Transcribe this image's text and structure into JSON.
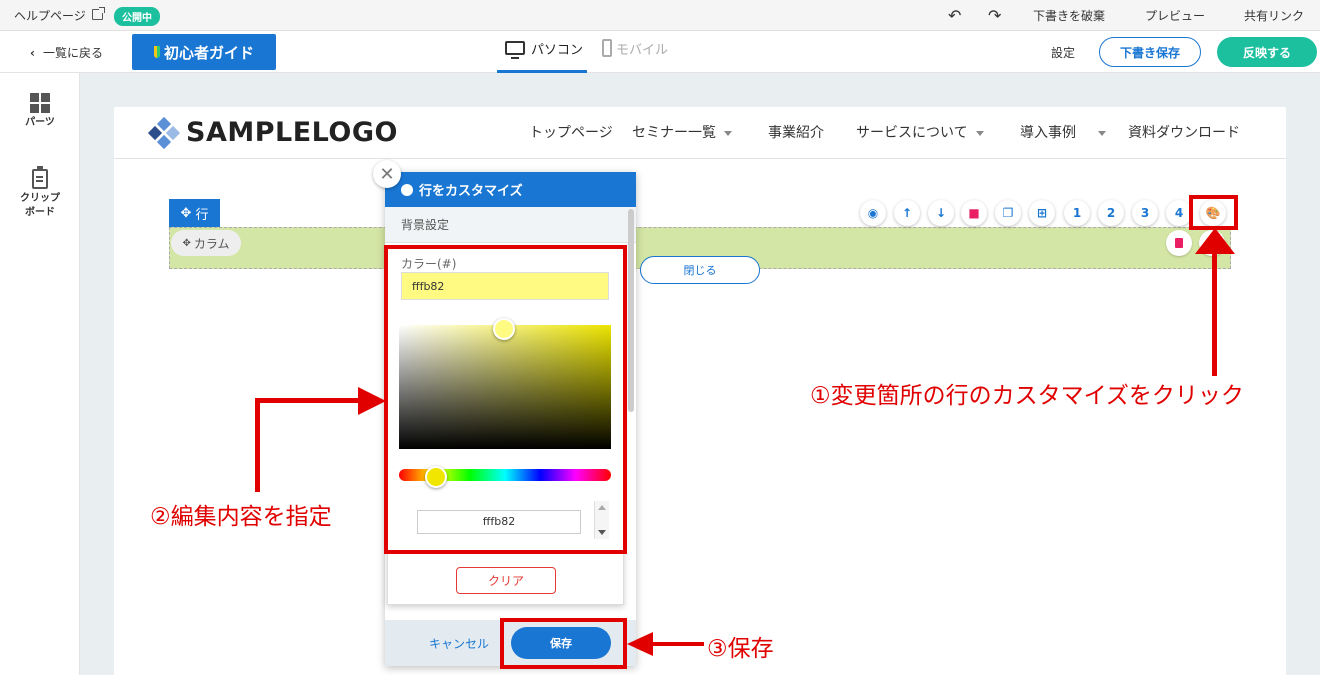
{
  "topbar": {
    "help_label": "ヘルプページ",
    "status_badge": "公開中",
    "discard_draft": "下書きを破棄",
    "preview": "プレビュー",
    "share_link": "共有リンク"
  },
  "toolbar": {
    "back_label": "一覧に戻る",
    "guide_label": "初心者ガイド",
    "device_tabs": [
      {
        "label": "パソコン",
        "active": true
      },
      {
        "label": "モバイル",
        "active": false
      }
    ],
    "settings_label": "設定",
    "draft_save_label": "下書き保存",
    "publish_label": "反映する"
  },
  "sidebar": {
    "items": [
      {
        "label": "パーツ",
        "icon": "grid-icon"
      },
      {
        "label": "クリップ\nボード",
        "icon": "clipboard-icon"
      }
    ]
  },
  "site": {
    "logo_text": "SAMPLELOGO",
    "nav": [
      {
        "label": "トップページ",
        "dropdown": false
      },
      {
        "label": "セミナー一覧",
        "dropdown": true
      },
      {
        "label": "事業紹介",
        "dropdown": false
      },
      {
        "label": "サービスについて",
        "dropdown": true
      },
      {
        "label": "導入事例",
        "dropdown": true
      },
      {
        "label": "資料ダウンロード",
        "dropdown": false
      }
    ]
  },
  "row": {
    "handle_label": "行",
    "column_label": "カラム",
    "close_label": "閉じる",
    "bg_color": "#d4e6a5",
    "tools": [
      "eye-icon",
      "arrow-up-icon",
      "arrow-down-icon",
      "trash-icon",
      "copy-icon",
      "add-icon",
      "1",
      "2",
      "3",
      "4",
      "palette-icon"
    ]
  },
  "panel": {
    "title": "行をカスタマイズ",
    "section_label": "背景設定",
    "color_label": "カラー(#)",
    "color_value": "fffb82",
    "hex_value": "fffb82",
    "clear_label": "クリア",
    "cancel_label": "キャンセル",
    "save_label": "保存"
  },
  "annotations": {
    "step1": "①変更箇所の行のカスタマイズをクリック",
    "step2": "②編集内容を指定",
    "step3": "③保存",
    "color": "#e00000"
  }
}
